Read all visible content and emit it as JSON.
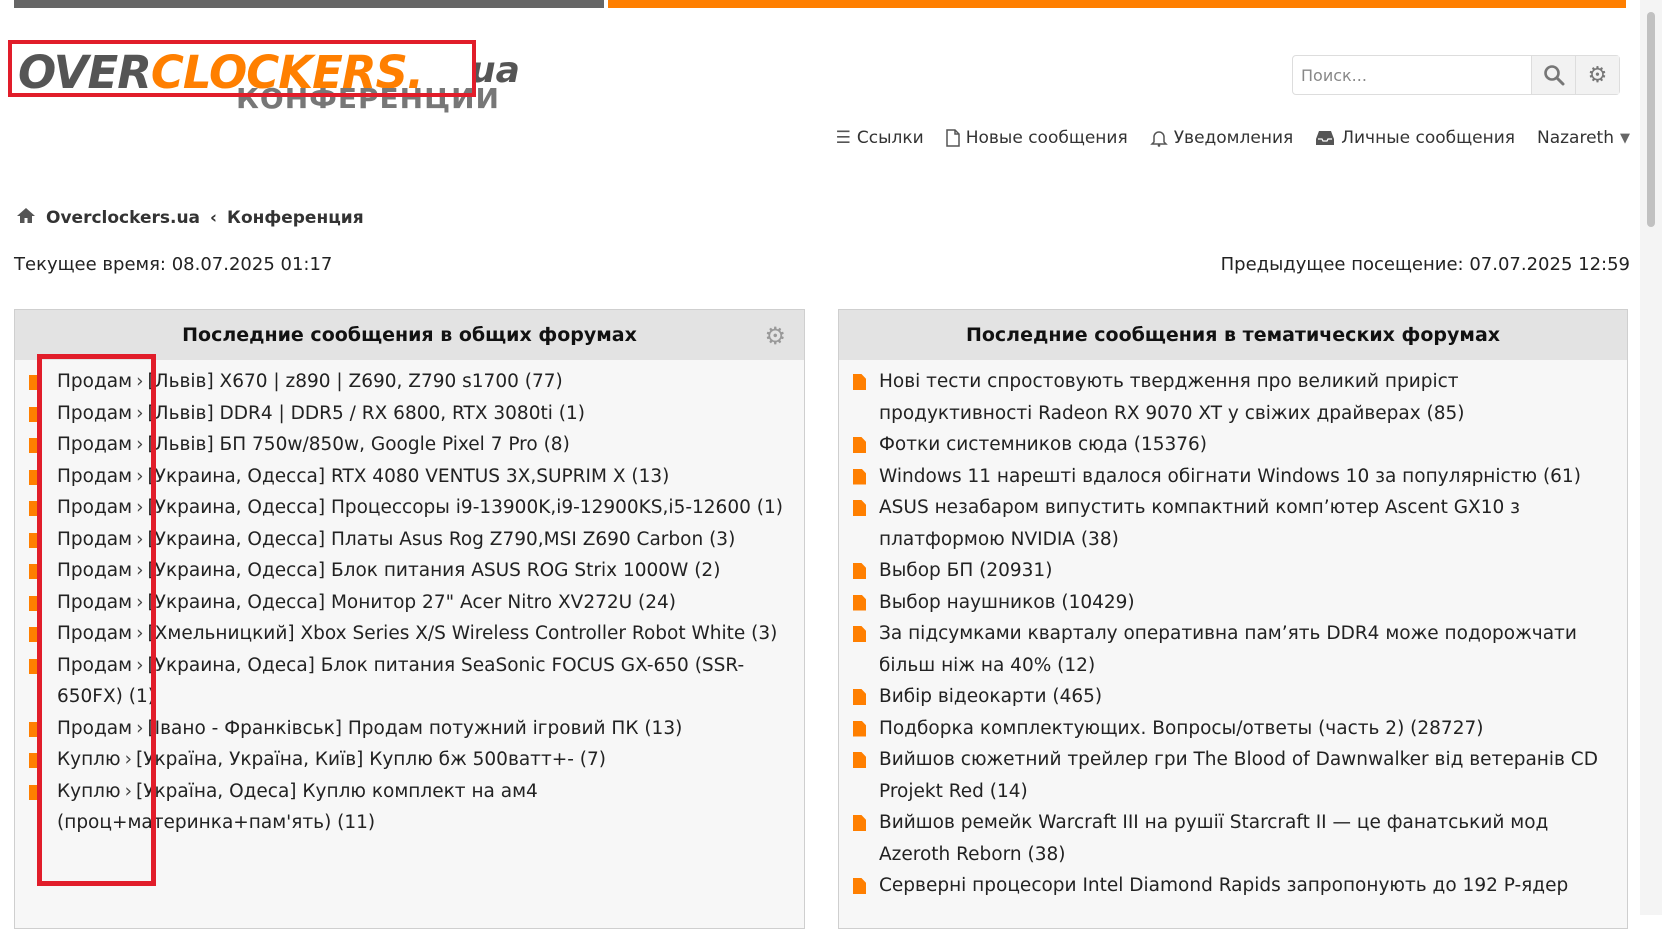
{
  "logo": {
    "over": "OVER",
    "clockers": "CLOCKERS.",
    "ua": "ua",
    "subtitle": "КОНФЕРЕНЦИИ"
  },
  "search": {
    "placeholder": "Поиск..."
  },
  "nav": {
    "links": "Ссылки",
    "new_posts": "Новые сообщения",
    "notifications": "Уведомления",
    "messages": "Личные сообщения",
    "user": "Nazareth"
  },
  "breadcrumb": {
    "home": "Overclockers.ua",
    "sep": "‹",
    "current": "Конференция"
  },
  "status": {
    "current_time": "Текущее время: 08.07.2025 01:17",
    "previous_visit": "Предыдущее посещение: 07.07.2025 12:59"
  },
  "left_panel": {
    "title": "Последние сообщения в общих форумах",
    "posts": [
      {
        "cat": "Продам",
        "text": "[Львів] X670 | z890 | Z690, Z790 s1700 (77)"
      },
      {
        "cat": "Продам",
        "text": "[Львів] DDR4 | DDR5 / RX 6800, RTX 3080ti (1)"
      },
      {
        "cat": "Продам",
        "text": "[Львів] БП 750w/850w, Google Pixel 7 Pro (8)"
      },
      {
        "cat": "Продам",
        "text": "[Украина, Одесса] RTX 4080 VENTUS 3X,SUPRIM X (13)"
      },
      {
        "cat": "Продам",
        "text": "[Украина, Одесса] Процессоры i9-13900K,i9-12900KS,i5-12600 (1)"
      },
      {
        "cat": "Продам",
        "text": "[Украина, Одесса] Платы Asus Rog Z790,MSI Z690 Carbon (3)"
      },
      {
        "cat": "Продам",
        "text": "[Украина, Одесса] Блок питания ASUS ROG Strix 1000W (2)"
      },
      {
        "cat": "Продам",
        "text": "[Украина, Одесса] Монитор 27\" Acer Nitro XV272U (24)"
      },
      {
        "cat": "Продам",
        "text": "[Хмельницкий] Xbox Series X/S Wireless Controller Robot White (3)"
      },
      {
        "cat": "Продам",
        "text": "[Украина, Одеса] Блок питания SeaSonic FOCUS GX-650 (SSR-650FX) (1)"
      },
      {
        "cat": "Продам",
        "text": "[Івано - Франківськ] Продам потужний ігровий ПК (13)"
      },
      {
        "cat": "Куплю",
        "text": "[Україна, Україна, Київ] Куплю бж 500ватт+- (7)"
      },
      {
        "cat": "Куплю",
        "text": "[Україна, Одеса] Куплю комплект на ам4 (проц+материнка+пам'ять) (11)"
      }
    ]
  },
  "right_panel": {
    "title": "Последние сообщения в тематических форумах",
    "posts": [
      "Нові тести спростовують твердження про великий приріст продуктивності Radeon RX 9070 XT у свіжих драйверах (85)",
      "Фотки системников сюда (15376)",
      "Windows 11 нарешті вдалося обігнати Windows 10 за популярністю (61)",
      "ASUS незабаром випустить компактний комп’ютер Ascent GX10 з платформою NVIDIA (38)",
      "Выбор БП (20931)",
      "Выбор наушников (10429)",
      "За підсумками кварталу оперативна пам’ять DDR4 може подорожчати більш ніж на 40% (12)",
      "Вибір відеокарти (465)",
      "Подборка комплектующих. Вопросы/ответы (часть 2) (28727)",
      "Вийшов сюжетний трейлер гри The Blood of Dawnwalker від ветеранів CD Projekt Red (14)",
      "Вийшов ремейк Warcraft III на рушії Starcraft II — це фанатський мод Azeroth Reborn (38)",
      "Серверні процесори Intel Diamond Rapids запропонують до 192 P-ядер"
    ]
  },
  "icons": {
    "search": "search-icon",
    "settings": "gear-icon",
    "menu": "menu-icon",
    "document": "document-icon",
    "bell": "bell-icon",
    "inbox": "inbox-icon",
    "chevron": "chevron-down-icon",
    "home": "home-icon"
  },
  "colors": {
    "accent": "#ff7f00",
    "highlight": "#e11d2a",
    "panel_header": "#e3e3e3"
  }
}
